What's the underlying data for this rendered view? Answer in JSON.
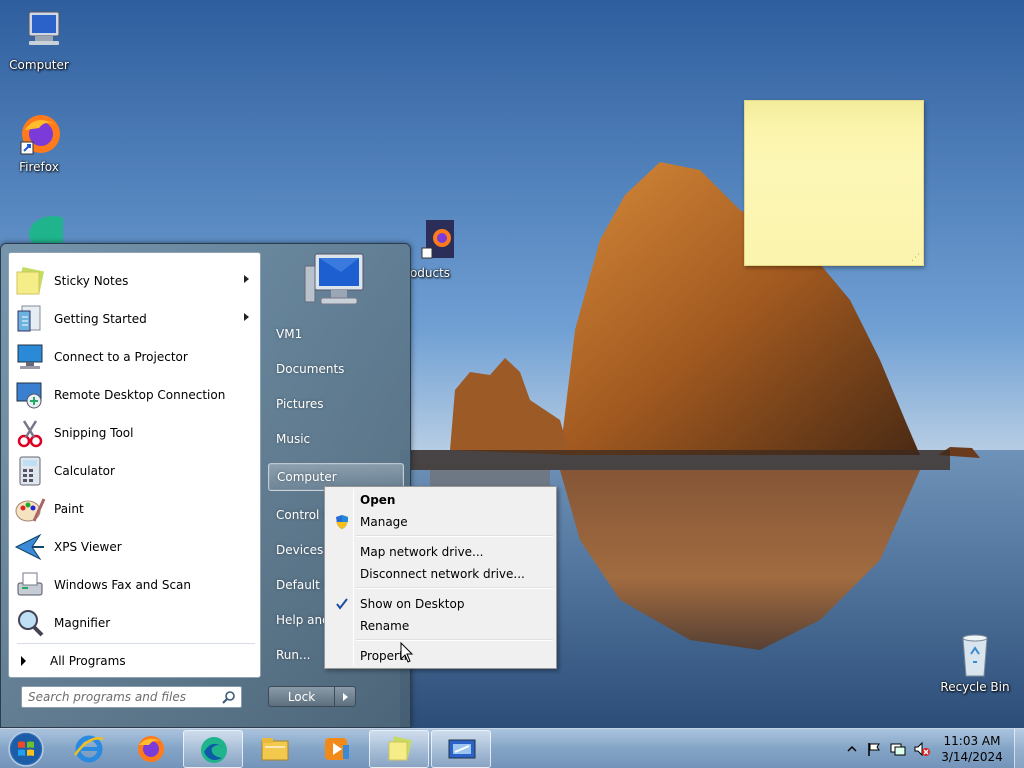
{
  "desktop": {
    "icons": [
      {
        "label": "Computer",
        "icon": "computer-icon"
      },
      {
        "label": "Firefox",
        "icon": "firefox-icon"
      },
      {
        "label": "oducts",
        "icon": "firefox-shortcut-icon"
      },
      {
        "label": "Recycle Bin",
        "icon": "recycle-bin-icon"
      }
    ],
    "sticky_note": {
      "text": "",
      "color": "#fdf7b6"
    }
  },
  "start_menu": {
    "programs": [
      {
        "label": "Sticky Notes",
        "icon": "sticky-notes-icon",
        "has_submenu": true
      },
      {
        "label": "Getting Started",
        "icon": "getting-started-icon",
        "has_submenu": true
      },
      {
        "label": "Connect to a Projector",
        "icon": "projector-icon",
        "has_submenu": false
      },
      {
        "label": "Remote Desktop Connection",
        "icon": "remote-desktop-icon",
        "has_submenu": false
      },
      {
        "label": "Snipping Tool",
        "icon": "snipping-tool-icon",
        "has_submenu": false
      },
      {
        "label": "Calculator",
        "icon": "calculator-icon",
        "has_submenu": false
      },
      {
        "label": "Paint",
        "icon": "paint-icon",
        "has_submenu": false
      },
      {
        "label": "XPS Viewer",
        "icon": "xps-viewer-icon",
        "has_submenu": false
      },
      {
        "label": "Windows Fax and Scan",
        "icon": "fax-scan-icon",
        "has_submenu": false
      },
      {
        "label": "Magnifier",
        "icon": "magnifier-icon",
        "has_submenu": false
      }
    ],
    "all_programs": "All Programs",
    "search_placeholder": "Search programs and files",
    "right_links": [
      {
        "label": "VM1"
      },
      {
        "label": "Documents"
      },
      {
        "label": "Pictures"
      },
      {
        "label": "Music"
      },
      {
        "label": "Computer",
        "highlighted": true
      },
      {
        "label": "Control P"
      },
      {
        "label": "Devices a"
      },
      {
        "label": "Default P"
      },
      {
        "label": "Help and"
      },
      {
        "label": "Run..."
      }
    ],
    "lock_label": "Lock"
  },
  "context_menu": {
    "items": [
      {
        "label": "Open",
        "bold": true
      },
      {
        "label": "Manage",
        "icon": "uac-shield-icon"
      },
      {
        "label": "Map network drive..."
      },
      {
        "label": "Disconnect network drive..."
      },
      {
        "label": "Show on Desktop",
        "checked": true
      },
      {
        "label": "Rename"
      },
      {
        "label": "Properti"
      }
    ]
  },
  "taskbar": {
    "apps": [
      {
        "name": "internet-explorer-icon",
        "active": false
      },
      {
        "name": "firefox-icon",
        "active": false
      },
      {
        "name": "edge-icon",
        "active": true
      },
      {
        "name": "file-explorer-icon",
        "active": false
      },
      {
        "name": "media-player-icon",
        "active": false
      },
      {
        "name": "sticky-notes-icon",
        "active": true
      },
      {
        "name": "remote-desktop-icon",
        "active": true
      }
    ],
    "clock": {
      "time": "11:03 AM",
      "date": "3/14/2024"
    }
  },
  "colors": {
    "accent": "#3a74b8",
    "sticky": "#fdf7b6",
    "menu_bg": "#f0f0f0"
  }
}
